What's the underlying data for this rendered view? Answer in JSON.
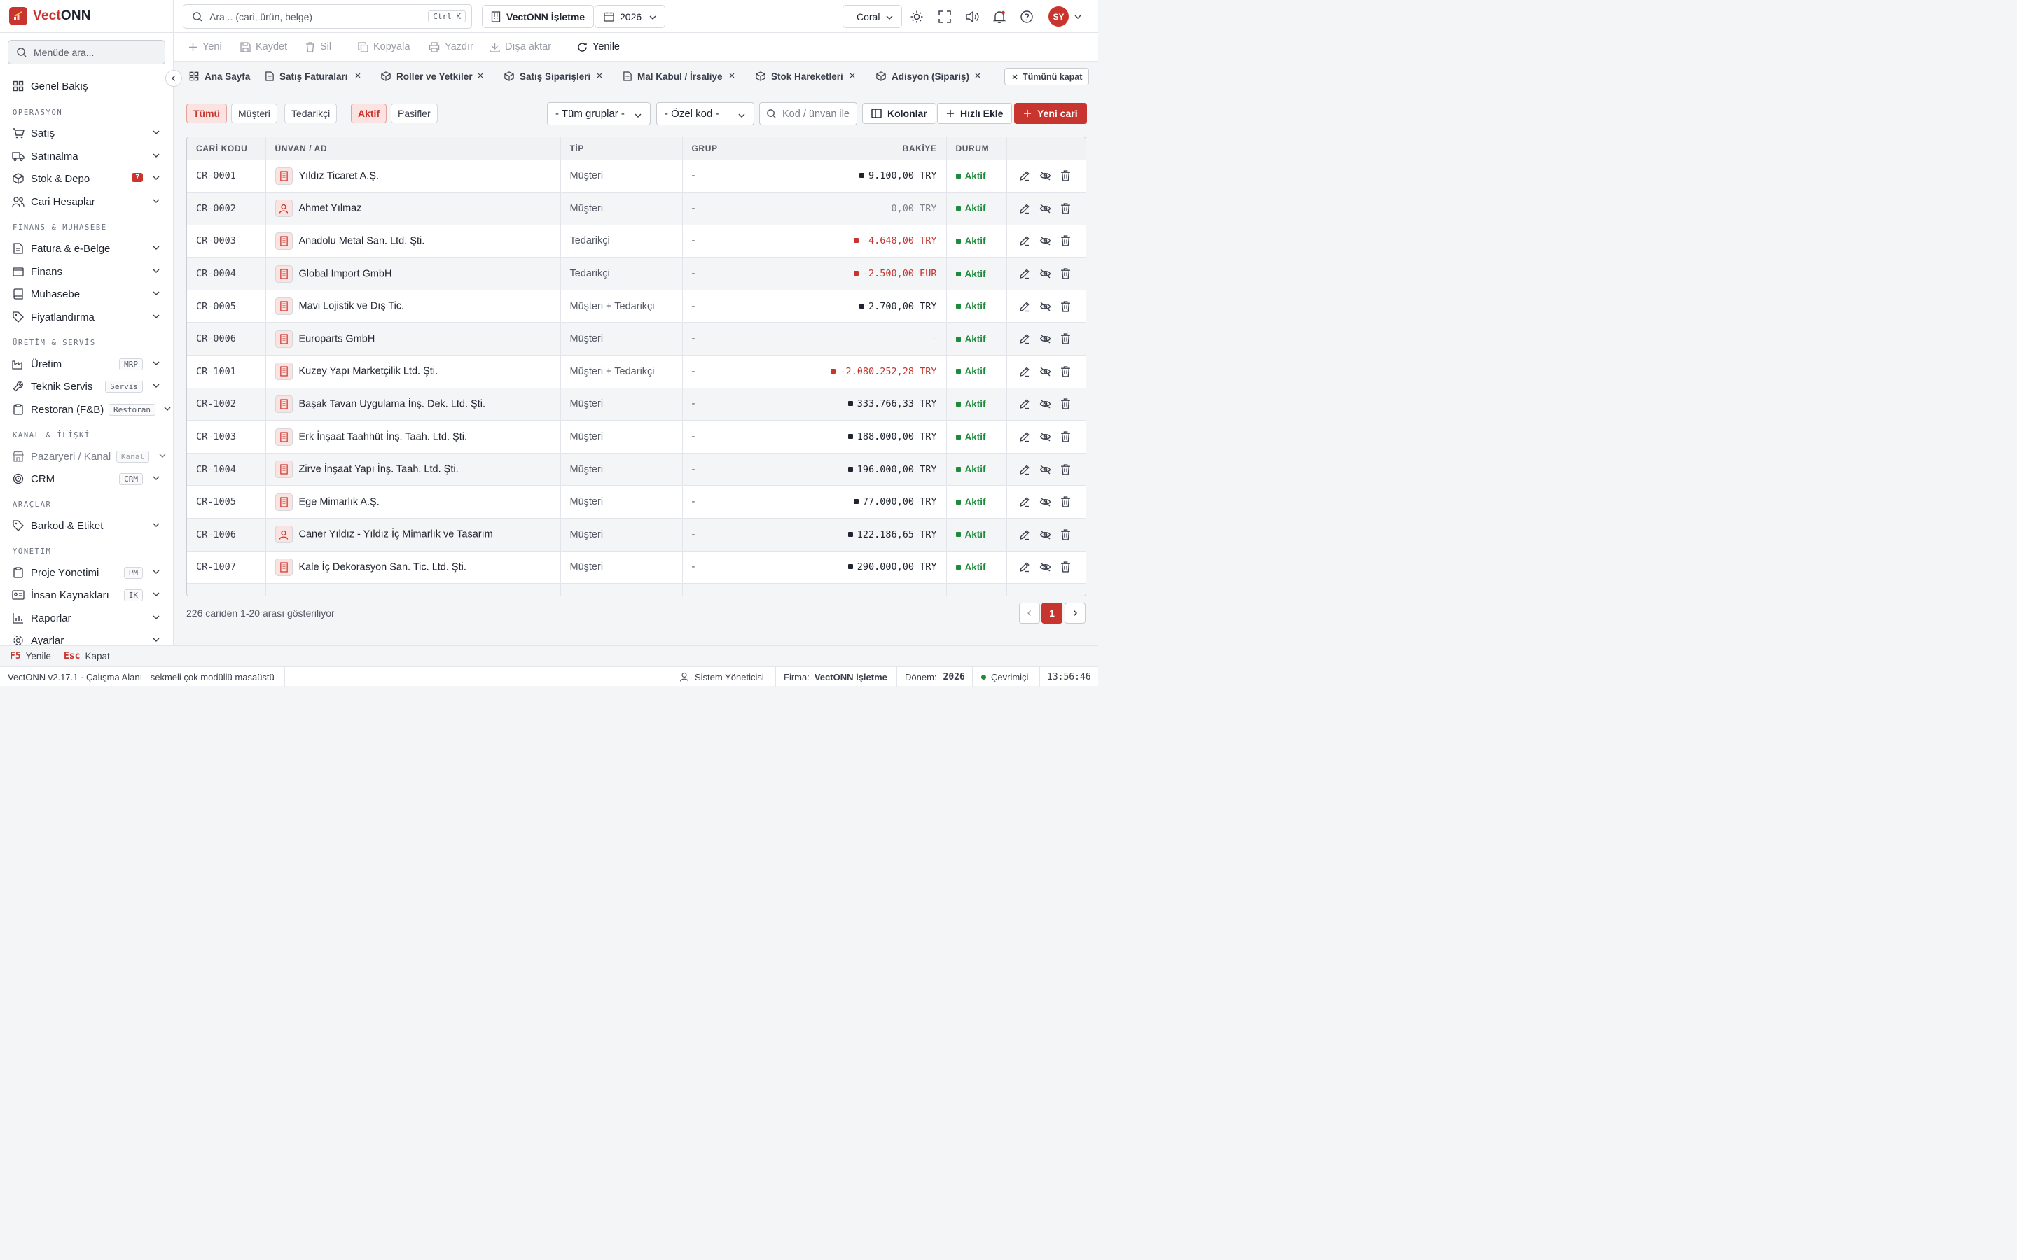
{
  "app": {
    "logo_a": "Vect",
    "logo_b": "ONN"
  },
  "sidebar": {
    "search_placeholder": "Menüde ara...",
    "home": "Genel Bakış",
    "sections": [
      "OPERASYON",
      "FİNANS & MUHASEBE",
      "ÜRETİM & SERVİS",
      "KANAL & İLİŞKİ",
      "ARAÇLAR",
      "YÖNETİM"
    ],
    "items": [
      {
        "label": "Satış"
      },
      {
        "label": "Satınalma"
      },
      {
        "label": "Stok & Depo",
        "badge": "7"
      },
      {
        "label": "Cari Hesaplar"
      },
      {
        "label": "Fatura & e-Belge"
      },
      {
        "label": "Finans"
      },
      {
        "label": "Muhasebe"
      },
      {
        "label": "Fiyatlandırma"
      },
      {
        "label": "Üretim",
        "tag": "MRP"
      },
      {
        "label": "Teknik Servis",
        "tag": "Servis"
      },
      {
        "label": "Restoran (F&B)",
        "tag": "Restoran"
      },
      {
        "label": "Pazaryeri / Kanal",
        "tag": "Kanal"
      },
      {
        "label": "CRM",
        "tag": "CRM"
      },
      {
        "label": "Barkod & Etiket"
      },
      {
        "label": "Proje Yönetimi",
        "tag": "PM"
      },
      {
        "label": "İnsan Kaynakları",
        "tag": "İK"
      },
      {
        "label": "Raporlar"
      },
      {
        "label": "Ayarlar"
      }
    ]
  },
  "topbar": {
    "search_placeholder": "Ara... (cari, ürün, belge)",
    "shortcut": "Ctrl K",
    "company": "VectONN İşletme",
    "year": "2026",
    "theme": "Coral",
    "avatar": "SY"
  },
  "toolbar": {
    "new": "Yeni",
    "save": "Kaydet",
    "delete": "Sil",
    "copy": "Kopyala",
    "print": "Yazdır",
    "export": "Dışa aktar",
    "refresh": "Yenile"
  },
  "tabs": {
    "items": [
      "Ana Sayfa",
      "Satış Faturaları",
      "Roller ve Yetkiler",
      "Satış Siparişleri",
      "Mal Kabul / İrsaliye",
      "Stok Hareketleri",
      "Adisyon (Sipariş)"
    ],
    "close_all": "Tümünü kapat"
  },
  "filters": {
    "all": "Tümü",
    "customer": "Müşteri",
    "supplier": "Tedarikçi",
    "active": "Aktif",
    "passive": "Pasifler",
    "groups": "- Tüm gruplar -",
    "special_code": "- Özel kod -",
    "search_placeholder": "Kod / ünvan ile",
    "columns": "Kolonlar",
    "quick_add": "Hızlı Ekle",
    "new_account": "Yeni cari"
  },
  "table": {
    "headers": [
      "CARİ KODU",
      "ÜNVAN / AD",
      "TİP",
      "GRUP",
      "BAKİYE",
      "DURUM"
    ],
    "rows": [
      {
        "code": "CR-0001",
        "name": "Yıldız Ticaret A.Ş.",
        "kind": "company",
        "type": "Müşteri",
        "group": "-",
        "balance": "9.100,00 TRY",
        "sign": "pos",
        "status": "Aktif"
      },
      {
        "code": "CR-0002",
        "name": "Ahmet Yılmaz",
        "kind": "person",
        "type": "Müşteri",
        "group": "-",
        "balance": "0,00 TRY",
        "sign": "zero",
        "status": "Aktif"
      },
      {
        "code": "CR-0003",
        "name": "Anadolu Metal San. Ltd. Şti.",
        "kind": "company",
        "type": "Tedarikçi",
        "group": "-",
        "balance": "-4.648,00 TRY",
        "sign": "neg",
        "status": "Aktif"
      },
      {
        "code": "CR-0004",
        "name": "Global Import GmbH",
        "kind": "company",
        "type": "Tedarikçi",
        "group": "-",
        "balance": "-2.500,00 EUR",
        "sign": "neg",
        "status": "Aktif"
      },
      {
        "code": "CR-0005",
        "name": "Mavi Lojistik ve Dış Tic.",
        "kind": "company",
        "type": "Müşteri + Tedarikçi",
        "group": "-",
        "balance": "2.700,00 TRY",
        "sign": "pos",
        "status": "Aktif"
      },
      {
        "code": "CR-0006",
        "name": "Europarts GmbH",
        "kind": "company",
        "type": "Müşteri",
        "group": "-",
        "balance": "-",
        "sign": "zero",
        "status": "Aktif"
      },
      {
        "code": "CR-1001",
        "name": "Kuzey Yapı Marketçilik Ltd. Şti.",
        "kind": "company",
        "type": "Müşteri + Tedarikçi",
        "group": "-",
        "balance": "-2.080.252,28 TRY",
        "sign": "neg",
        "status": "Aktif"
      },
      {
        "code": "CR-1002",
        "name": "Başak Tavan Uygulama İnş. Dek. Ltd. Şti.",
        "kind": "company",
        "type": "Müşteri",
        "group": "-",
        "balance": "333.766,33 TRY",
        "sign": "pos",
        "status": "Aktif"
      },
      {
        "code": "CR-1003",
        "name": "Erk İnşaat Taahhüt İnş. Taah. Ltd. Şti.",
        "kind": "company",
        "type": "Müşteri",
        "group": "-",
        "balance": "188.000,00 TRY",
        "sign": "pos",
        "status": "Aktif"
      },
      {
        "code": "CR-1004",
        "name": "Zirve İnşaat Yapı İnş. Taah. Ltd. Şti.",
        "kind": "company",
        "type": "Müşteri",
        "group": "-",
        "balance": "196.000,00 TRY",
        "sign": "pos",
        "status": "Aktif"
      },
      {
        "code": "CR-1005",
        "name": "Ege Mimarlık A.Ş.",
        "kind": "company",
        "type": "Müşteri",
        "group": "-",
        "balance": "77.000,00 TRY",
        "sign": "pos",
        "status": "Aktif"
      },
      {
        "code": "CR-1006",
        "name": "Caner Yıldız - Yıldız İç Mimarlık ve Tasarım",
        "kind": "person",
        "type": "Müşteri",
        "group": "-",
        "balance": "122.186,65 TRY",
        "sign": "pos",
        "status": "Aktif"
      },
      {
        "code": "CR-1007",
        "name": "Kale İç Dekorasyon San. Tic. Ltd. Şti.",
        "kind": "company",
        "type": "Müşteri",
        "group": "-",
        "balance": "290.000,00 TRY",
        "sign": "pos",
        "status": "Aktif"
      }
    ],
    "summary": "226 cariden 1-20 arası gösteriliyor",
    "page": "1"
  },
  "hints": {
    "f5_key": "F5",
    "f5_label": "Yenile",
    "esc_key": "Esc",
    "esc_label": "Kapat"
  },
  "statusbar": {
    "version": "VectONN v2.17.1  · Çalışma Alanı - sekmeli çok modüllü masaüstü",
    "user": "Sistem Yöneticisi",
    "company_label": "Firma:",
    "company": "VectONN İşletme",
    "period_label": "Dönem:",
    "period": "2026",
    "online": "Çevrimiçi",
    "time": "13:56:46"
  },
  "colors": {
    "accent": "#c8342e",
    "success": "#1e8a3c"
  }
}
